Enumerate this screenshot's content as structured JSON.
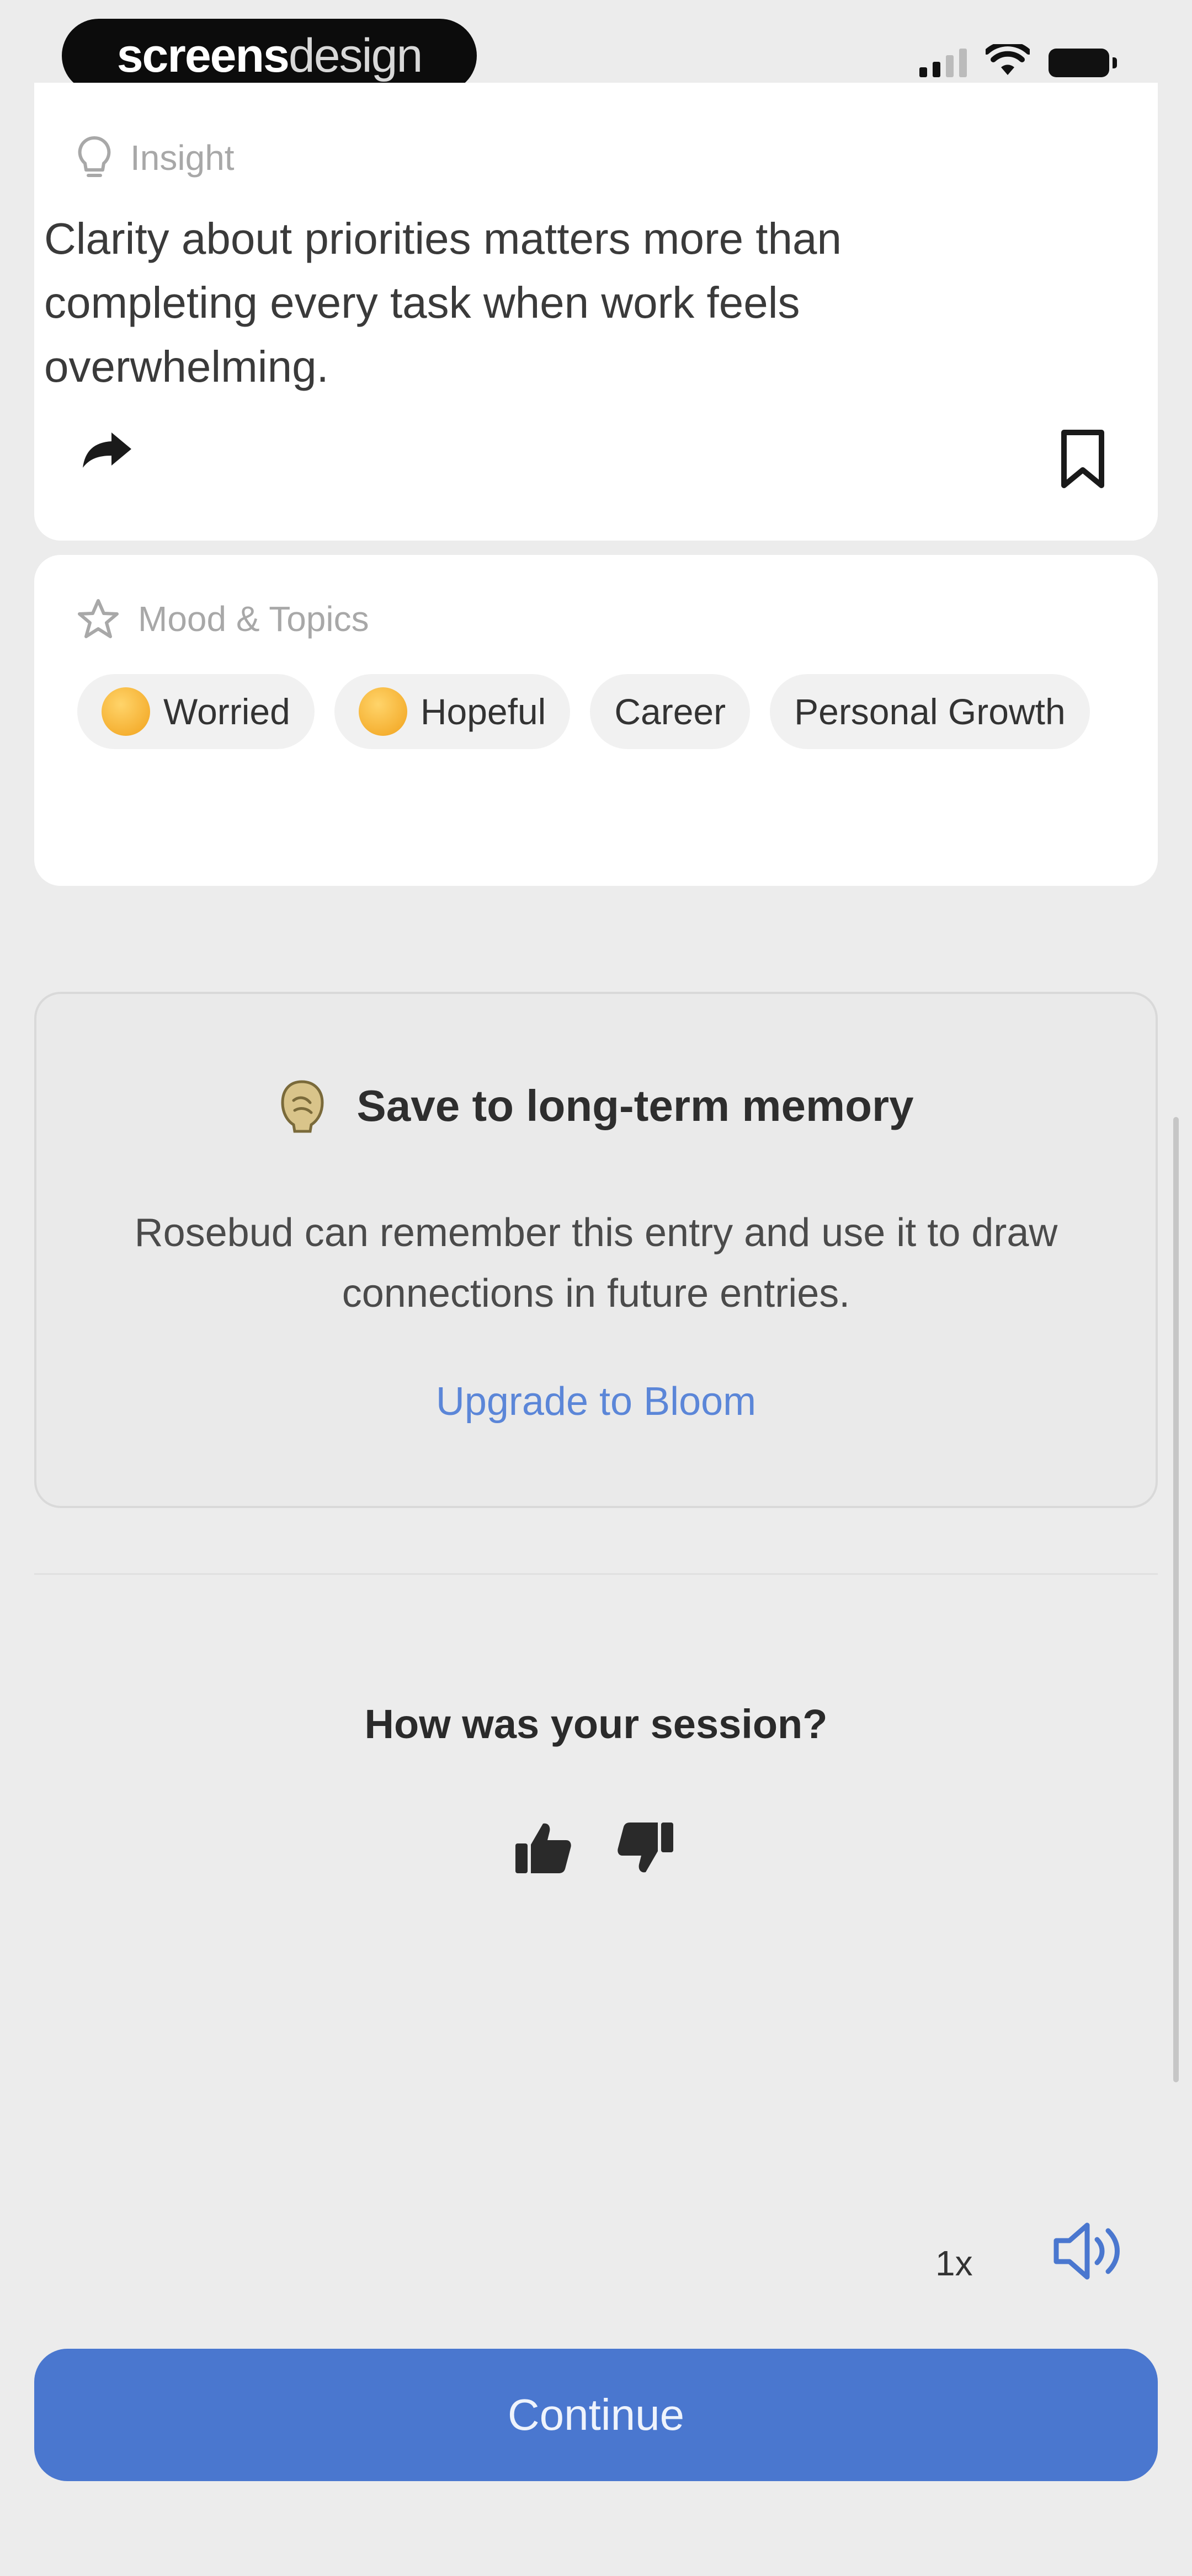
{
  "status_bar": {
    "watermark_bold": "screens",
    "watermark_light": "design",
    "icons": [
      "signal-icon",
      "wifi-icon",
      "battery-icon"
    ]
  },
  "insight": {
    "label": "Insight",
    "text": "Clarity about priorities matters more than completing every task when work feels overwhelming.",
    "icons": [
      "lightbulb-icon",
      "share-icon",
      "bookmark-icon"
    ]
  },
  "mood": {
    "label": "Mood & Topics",
    "chips": [
      {
        "label": "Worried",
        "emoji": true
      },
      {
        "label": "Hopeful",
        "emoji": true
      },
      {
        "label": "Career",
        "emoji": false
      },
      {
        "label": "Personal Growth",
        "emoji": false
      }
    ]
  },
  "memory": {
    "title": "Save to long-term memory",
    "body": "Rosebud can remember this entry and use it to draw connections in future entries.",
    "link": "Upgrade to Bloom"
  },
  "session": {
    "question": "How was your session?"
  },
  "playback": {
    "speed": "1x"
  },
  "continue_label": "Continue",
  "colors": {
    "accent": "#4a77cf",
    "link": "#5b86d8",
    "background": "#ececec",
    "card": "#ffffff"
  }
}
